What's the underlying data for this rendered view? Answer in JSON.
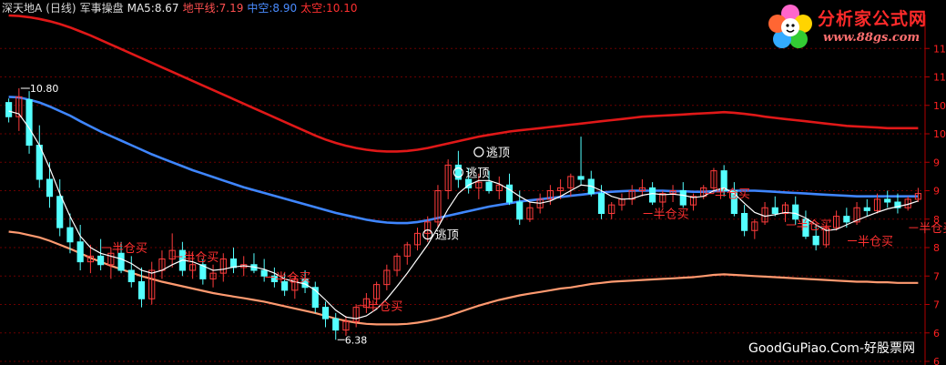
{
  "header": {
    "stock_name": "深天地A",
    "period": "(日线)",
    "indicator_name": "军事操盘",
    "ma_label": "MA5:8.67",
    "ground_label": "地平线:7.19",
    "mid_label": "中空:8.90",
    "top_label": "太空:10.10",
    "colors": {
      "stock": "#d8d8d8",
      "ma": "#e8e8e8",
      "ground": "#ff5050",
      "mid": "#4a8cff",
      "top": "#ff3030"
    }
  },
  "logo": {
    "title": "分析家公式网",
    "url": "www.88gs.com"
  },
  "watermark": "GoodGuPiao.Com-好股票网",
  "chart_data": {
    "type": "candlestick",
    "y_range": [
      6,
      12
    ],
    "y_ticks": [
      6,
      6.5,
      7,
      7.5,
      8,
      8.5,
      9,
      9.5,
      10,
      10.5,
      11,
      11.5
    ],
    "y_tick_labels": [
      "6",
      "6",
      "7",
      "7",
      "8",
      "8",
      "9",
      "9",
      "10",
      "10",
      "11",
      "11"
    ],
    "high_marker": {
      "text": "10.80",
      "value": 10.8
    },
    "low_marker": {
      "text": "6.38",
      "value": 6.38
    },
    "annotations_sell": [
      {
        "text": "逃顶",
        "index": 46,
        "value": 9.68
      },
      {
        "text": "逃顶",
        "index": 44,
        "value": 9.32
      },
      {
        "text": "逃顶",
        "index": 41,
        "value": 8.23
      }
    ],
    "annotations_buy": [
      {
        "text": "半仓买",
        "index": 10,
        "value": 8.0
      },
      {
        "text": "半仓买",
        "index": 17,
        "value": 7.84
      },
      {
        "text": "半仓买",
        "index": 26,
        "value": 7.48
      },
      {
        "text": "半仓买",
        "index": 35,
        "value": 6.98
      },
      {
        "text": "半仓买",
        "index": 63,
        "value": 8.6
      },
      {
        "text": "半仓买",
        "index": 69,
        "value": 8.95
      },
      {
        "text": "半仓买",
        "index": 77,
        "value": 8.4
      },
      {
        "text": "半仓买",
        "index": 83,
        "value": 8.12
      },
      {
        "text": "半仓买",
        "index": 89,
        "value": 8.35
      }
    ],
    "ohlc": [
      [
        10.55,
        10.62,
        10.2,
        10.3
      ],
      [
        10.3,
        10.8,
        10.05,
        10.65
      ],
      [
        10.6,
        10.75,
        9.65,
        9.8
      ],
      [
        9.8,
        10.15,
        9.05,
        9.2
      ],
      [
        9.2,
        9.5,
        8.7,
        8.9
      ],
      [
        8.9,
        9.2,
        8.2,
        8.35
      ],
      [
        8.35,
        8.6,
        7.9,
        8.1
      ],
      [
        8.1,
        8.4,
        7.6,
        7.75
      ],
      [
        7.75,
        8.05,
        7.55,
        7.85
      ],
      [
        7.85,
        8.15,
        7.6,
        7.7
      ],
      [
        7.7,
        8.0,
        7.45,
        7.9
      ],
      [
        7.9,
        8.1,
        7.55,
        7.6
      ],
      [
        7.6,
        7.85,
        7.3,
        7.4
      ],
      [
        7.4,
        7.65,
        6.95,
        7.1
      ],
      [
        7.1,
        7.75,
        7.0,
        7.6
      ],
      [
        7.6,
        7.95,
        7.45,
        7.8
      ],
      [
        7.8,
        8.25,
        7.65,
        7.95
      ],
      [
        7.95,
        8.1,
        7.5,
        7.6
      ],
      [
        7.6,
        7.9,
        7.45,
        7.7
      ],
      [
        7.7,
        7.8,
        7.35,
        7.45
      ],
      [
        7.45,
        7.7,
        7.3,
        7.55
      ],
      [
        7.55,
        7.9,
        7.4,
        7.8
      ],
      [
        7.8,
        8.0,
        7.55,
        7.65
      ],
      [
        7.65,
        7.85,
        7.5,
        7.7
      ],
      [
        7.7,
        7.9,
        7.55,
        7.6
      ],
      [
        7.6,
        7.8,
        7.4,
        7.5
      ],
      [
        7.5,
        7.65,
        7.3,
        7.4
      ],
      [
        7.4,
        7.55,
        7.15,
        7.25
      ],
      [
        7.25,
        7.5,
        7.1,
        7.45
      ],
      [
        7.45,
        7.6,
        7.2,
        7.3
      ],
      [
        7.3,
        7.4,
        6.85,
        6.95
      ],
      [
        6.95,
        7.05,
        6.6,
        6.75
      ],
      [
        6.75,
        6.85,
        6.38,
        6.55
      ],
      [
        6.55,
        6.8,
        6.45,
        6.7
      ],
      [
        6.7,
        7.0,
        6.6,
        6.95
      ],
      [
        6.95,
        7.2,
        6.85,
        7.1
      ],
      [
        7.1,
        7.4,
        7.0,
        7.35
      ],
      [
        7.35,
        7.7,
        7.25,
        7.6
      ],
      [
        7.6,
        7.9,
        7.5,
        7.85
      ],
      [
        7.85,
        8.1,
        7.7,
        8.05
      ],
      [
        8.05,
        8.35,
        7.95,
        8.25
      ],
      [
        8.25,
        8.55,
        8.1,
        8.45
      ],
      [
        8.45,
        9.1,
        8.35,
        9.0
      ],
      [
        9.0,
        9.55,
        8.85,
        9.45
      ],
      [
        9.45,
        9.7,
        9.05,
        9.2
      ],
      [
        9.2,
        9.4,
        8.95,
        9.05
      ],
      [
        9.05,
        9.3,
        8.85,
        9.15
      ],
      [
        9.15,
        9.35,
        8.95,
        9.0
      ],
      [
        9.0,
        9.25,
        8.85,
        9.1
      ],
      [
        9.1,
        9.3,
        8.75,
        8.8
      ],
      [
        8.8,
        9.0,
        8.4,
        8.5
      ],
      [
        8.5,
        8.8,
        8.45,
        8.7
      ],
      [
        8.7,
        8.95,
        8.6,
        8.85
      ],
      [
        8.85,
        9.1,
        8.75,
        9.0
      ],
      [
        9.0,
        9.2,
        8.85,
        9.05
      ],
      [
        9.05,
        9.3,
        8.9,
        9.25
      ],
      [
        9.25,
        9.95,
        9.1,
        9.2
      ],
      [
        9.2,
        9.35,
        8.9,
        8.95
      ],
      [
        8.95,
        9.1,
        8.5,
        8.6
      ],
      [
        8.6,
        8.8,
        8.5,
        8.75
      ],
      [
        8.75,
        8.95,
        8.65,
        8.85
      ],
      [
        8.85,
        9.1,
        8.75,
        9.0
      ],
      [
        9.0,
        9.2,
        8.9,
        9.05
      ],
      [
        9.05,
        9.15,
        8.75,
        8.8
      ],
      [
        8.8,
        9.0,
        8.7,
        8.95
      ],
      [
        8.95,
        9.1,
        8.8,
        9.0
      ],
      [
        9.0,
        9.15,
        8.7,
        8.75
      ],
      [
        8.75,
        8.95,
        8.65,
        8.9
      ],
      [
        8.9,
        9.1,
        8.85,
        9.05
      ],
      [
        9.05,
        9.4,
        8.95,
        9.35
      ],
      [
        9.35,
        9.45,
        8.9,
        9.0
      ],
      [
        9.0,
        9.15,
        8.55,
        8.6
      ],
      [
        8.6,
        8.75,
        8.2,
        8.3
      ],
      [
        8.3,
        8.5,
        8.15,
        8.45
      ],
      [
        8.45,
        8.8,
        8.4,
        8.7
      ],
      [
        8.7,
        8.9,
        8.55,
        8.6
      ],
      [
        8.6,
        8.8,
        8.45,
        8.75
      ],
      [
        8.75,
        8.9,
        8.4,
        8.5
      ],
      [
        8.5,
        8.65,
        8.15,
        8.2
      ],
      [
        8.2,
        8.4,
        7.95,
        8.05
      ],
      [
        8.05,
        8.4,
        8.0,
        8.35
      ],
      [
        8.35,
        8.65,
        8.3,
        8.55
      ],
      [
        8.55,
        8.7,
        8.35,
        8.45
      ],
      [
        8.45,
        8.8,
        8.4,
        8.7
      ],
      [
        8.7,
        8.85,
        8.55,
        8.65
      ],
      [
        8.65,
        8.95,
        8.6,
        8.85
      ],
      [
        8.85,
        9.0,
        8.7,
        8.8
      ],
      [
        8.8,
        8.95,
        8.6,
        8.7
      ],
      [
        8.7,
        8.9,
        8.65,
        8.85
      ],
      [
        8.85,
        9.05,
        8.8,
        8.95
      ]
    ],
    "ma5": [
      10.4,
      10.35,
      10.1,
      9.8,
      9.4,
      8.95,
      8.55,
      8.2,
      8.0,
      7.9,
      7.85,
      7.8,
      7.72,
      7.6,
      7.55,
      7.6,
      7.7,
      7.78,
      7.75,
      7.68,
      7.6,
      7.62,
      7.66,
      7.68,
      7.66,
      7.62,
      7.55,
      7.45,
      7.4,
      7.36,
      7.25,
      7.08,
      6.9,
      6.78,
      6.75,
      6.8,
      6.92,
      7.1,
      7.32,
      7.55,
      7.8,
      8.05,
      8.35,
      8.68,
      8.95,
      9.1,
      9.18,
      9.18,
      9.12,
      9.02,
      8.9,
      8.8,
      8.78,
      8.82,
      8.9,
      9.0,
      9.1,
      9.08,
      9.0,
      8.9,
      8.85,
      8.86,
      8.92,
      8.95,
      8.93,
      8.94,
      8.92,
      8.88,
      8.9,
      9.0,
      9.05,
      8.95,
      8.78,
      8.62,
      8.55,
      8.58,
      8.62,
      8.6,
      8.52,
      8.4,
      8.3,
      8.32,
      8.4,
      8.48,
      8.55,
      8.62,
      8.68,
      8.72,
      8.76,
      8.82
    ],
    "ground_line": [
      8.28,
      8.26,
      8.22,
      8.18,
      8.12,
      8.05,
      7.98,
      7.9,
      7.82,
      7.75,
      7.68,
      7.62,
      7.56,
      7.5,
      7.45,
      7.4,
      7.36,
      7.32,
      7.28,
      7.24,
      7.2,
      7.17,
      7.14,
      7.11,
      7.08,
      7.05,
      7.01,
      6.97,
      6.93,
      6.89,
      6.85,
      6.8,
      6.75,
      6.71,
      6.68,
      6.66,
      6.65,
      6.65,
      6.65,
      6.66,
      6.68,
      6.71,
      6.75,
      6.8,
      6.86,
      6.92,
      6.98,
      7.03,
      7.08,
      7.12,
      7.16,
      7.19,
      7.22,
      7.25,
      7.28,
      7.3,
      7.33,
      7.36,
      7.38,
      7.4,
      7.41,
      7.42,
      7.43,
      7.44,
      7.45,
      7.46,
      7.47,
      7.48,
      7.5,
      7.52,
      7.53,
      7.52,
      7.51,
      7.5,
      7.49,
      7.48,
      7.47,
      7.46,
      7.45,
      7.44,
      7.43,
      7.42,
      7.41,
      7.4,
      7.4,
      7.39,
      7.39,
      7.38,
      7.38,
      7.38
    ],
    "mid_line": [
      10.65,
      10.64,
      10.6,
      10.55,
      10.48,
      10.4,
      10.32,
      10.22,
      10.13,
      10.04,
      9.96,
      9.88,
      9.8,
      9.72,
      9.64,
      9.57,
      9.5,
      9.43,
      9.36,
      9.3,
      9.24,
      9.18,
      9.12,
      9.06,
      9.01,
      8.96,
      8.91,
      8.86,
      8.81,
      8.76,
      8.71,
      8.66,
      8.61,
      8.57,
      8.53,
      8.49,
      8.46,
      8.44,
      8.43,
      8.43,
      8.45,
      8.48,
      8.52,
      8.56,
      8.6,
      8.64,
      8.68,
      8.72,
      8.75,
      8.78,
      8.81,
      8.83,
      8.85,
      8.87,
      8.89,
      8.91,
      8.93,
      8.95,
      8.97,
      8.98,
      8.99,
      9.0,
      9.0,
      9.0,
      9.0,
      8.99,
      8.99,
      8.98,
      8.98,
      8.99,
      9.0,
      9.0,
      9.0,
      9.0,
      8.99,
      8.98,
      8.97,
      8.96,
      8.95,
      8.94,
      8.93,
      8.92,
      8.91,
      8.9,
      8.9,
      8.9,
      8.9,
      8.9,
      8.9,
      8.9
    ],
    "top_line": [
      12.08,
      12.07,
      12.05,
      12.02,
      11.98,
      11.93,
      11.87,
      11.8,
      11.73,
      11.65,
      11.57,
      11.49,
      11.41,
      11.33,
      11.25,
      11.17,
      11.09,
      11.01,
      10.93,
      10.85,
      10.77,
      10.69,
      10.61,
      10.53,
      10.45,
      10.37,
      10.29,
      10.21,
      10.13,
      10.05,
      9.97,
      9.9,
      9.84,
      9.79,
      9.75,
      9.72,
      9.7,
      9.69,
      9.69,
      9.7,
      9.72,
      9.75,
      9.79,
      9.83,
      9.87,
      9.91,
      9.95,
      9.98,
      10.01,
      10.04,
      10.06,
      10.08,
      10.1,
      10.12,
      10.14,
      10.16,
      10.18,
      10.2,
      10.22,
      10.24,
      10.26,
      10.28,
      10.3,
      10.31,
      10.32,
      10.33,
      10.34,
      10.35,
      10.36,
      10.37,
      10.38,
      10.37,
      10.35,
      10.33,
      10.3,
      10.28,
      10.26,
      10.24,
      10.22,
      10.2,
      10.18,
      10.16,
      10.14,
      10.13,
      10.12,
      10.11,
      10.1,
      10.1,
      10.1,
      10.1
    ],
    "colors": {
      "up": "#ff3c3c",
      "down": "#54ffff",
      "ma": "#ffffff",
      "ground": "#ff9a70",
      "mid": "#3f86ff",
      "top": "#e01818",
      "grid": "#6a0000",
      "axis": "#b00000",
      "tick": "#ff2020",
      "buy": "#ff3030",
      "sell": "#ffffff",
      "marker": "#ffffff"
    }
  }
}
